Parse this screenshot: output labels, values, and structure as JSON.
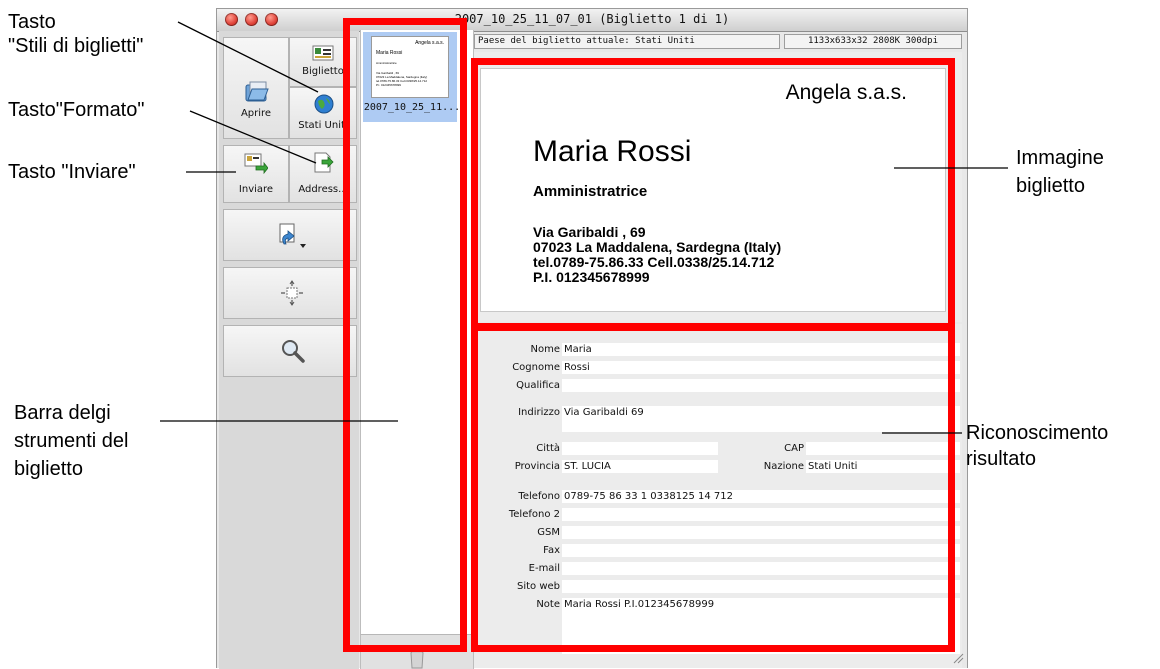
{
  "annotations": {
    "stili": [
      "Tasto",
      "\"Stili di biglietti\""
    ],
    "formato": "Tasto\"Formato\"",
    "inviare": "Tasto \"Inviare\"",
    "barra": [
      "Barra delgi",
      "strumenti del",
      "biglietto"
    ],
    "immagine": [
      "Immagine",
      "biglietto"
    ],
    "riconoscimento": [
      "Riconoscimento",
      "risultato"
    ]
  },
  "window": {
    "title": "2007_10_25_11_07_01 (Biglietto 1 di 1)"
  },
  "toolbar": {
    "open_label": "Aprire",
    "styles_label": "Biglietto",
    "format_label": "Stati Uniti",
    "send_label": "Inviare",
    "address_label": "Address...",
    "open_icon": "folder-icon",
    "styles_icon": "card-icon",
    "format_icon": "globe-icon",
    "send_icon": "send-card-icon",
    "address_icon": "address-book-icon",
    "rotate_icon": "rotate-icon",
    "crop_icon": "crop-icon",
    "zoom_icon": "magnifier-icon"
  },
  "thumbnail": {
    "caption": "2007_10_25_11...",
    "company": "Angela s.a.s.",
    "name": "Maria Rossi",
    "title": "Amministratrice",
    "lines": [
      "Via Garibaldi , 69",
      "07023 La Maddalena, Sardegna (Italy)",
      "tel.0789-75.86.33  Cell.0338/25.14.712",
      "P.I. 012345678999"
    ]
  },
  "status": {
    "country": "Paese del biglietto attuale: Stati Uniti",
    "info": "1133x633x32  2808K  300dpi"
  },
  "card": {
    "company": "Angela s.a.s.",
    "name": "Maria Rossi",
    "title": "Amministratrice",
    "address1": "Via Garibaldi , 69",
    "address2": "07023 La Maddalena, Sardegna (Italy)",
    "phone": "tel.0789-75.86.33   Cell.0338/25.14.712",
    "vat": "P.I. 012345678999"
  },
  "form": {
    "nome": {
      "label": "Nome",
      "value": "Maria"
    },
    "cognome": {
      "label": "Cognome",
      "value": "Rossi"
    },
    "qualifica": {
      "label": "Qualifica",
      "value": ""
    },
    "indirizzo": {
      "label": "Indirizzo",
      "value": "Via Garibaldi  69"
    },
    "citta": {
      "label": "Città",
      "value": ""
    },
    "cap": {
      "label": "CAP",
      "value": ""
    },
    "provincia": {
      "label": "Provincia",
      "value": "ST. LUCIA"
    },
    "nazione": {
      "label": "Nazione",
      "value": "Stati Uniti"
    },
    "telefono": {
      "label": "Telefono",
      "value": "0789-75 86 33 1 0338125 14 712"
    },
    "telefono2": {
      "label": "Telefono 2",
      "value": ""
    },
    "gsm": {
      "label": "GSM",
      "value": ""
    },
    "fax": {
      "label": "Fax",
      "value": ""
    },
    "email": {
      "label": "E-mail",
      "value": ""
    },
    "sito": {
      "label": "Sito web",
      "value": ""
    },
    "note": {
      "label": "Note",
      "value": "Maria Rossi P.I.012345678999"
    }
  },
  "colors": {
    "highlight": "#ff0000",
    "selection": "#aecbf3"
  }
}
